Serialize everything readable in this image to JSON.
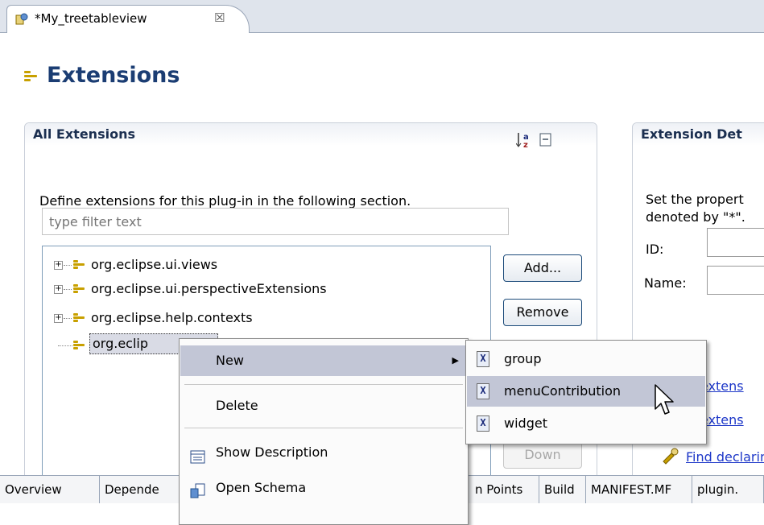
{
  "editor_tab": {
    "title": "*My_treetableview",
    "close_glyph": "☒",
    "icon": "plugin-manifest-icon"
  },
  "page": {
    "title": "Extensions",
    "icon": "extensions-icon"
  },
  "all_extensions": {
    "title": "All Extensions",
    "description": "Define extensions for this plug-in in the following section.",
    "filter_placeholder": "type filter text",
    "sort_icon": "sort-alphabetically-icon",
    "collapse_icon": "collapse-all-icon",
    "tree_items": [
      {
        "label": "org.eclipse.ui.views",
        "expandable": true
      },
      {
        "label": "org.eclipse.ui.perspectiveExtensions",
        "expandable": true
      },
      {
        "label": "org.eclipse.help.contexts",
        "expandable": true
      },
      {
        "label": "org.eclip",
        "expandable": false,
        "selected": true
      }
    ],
    "buttons": {
      "add": "Add...",
      "remove": "Remove",
      "down": "Down"
    }
  },
  "extension_details": {
    "title": "Extension Det",
    "description_line1": "Set the propert",
    "description_line2": "denoted by \"*\".",
    "id_label": "ID:",
    "name_label": "Name:",
    "links": [
      "extens",
      "extens",
      "Find declarin"
    ]
  },
  "context_menu": {
    "items": [
      {
        "label": "New",
        "has_submenu": true,
        "highlighted": true
      },
      {
        "label": "Delete"
      },
      {
        "label": "Show Description",
        "icon": "show-description-icon"
      },
      {
        "label": "Open Schema",
        "icon": "open-schema-icon"
      }
    ]
  },
  "submenu": {
    "items": [
      {
        "label": "group",
        "icon": "xml-element-icon"
      },
      {
        "label": "menuContribution",
        "icon": "xml-element-icon",
        "highlighted": true
      },
      {
        "label": "widget",
        "icon": "xml-element-icon"
      }
    ]
  },
  "bottom_tabs": [
    "Overview",
    "Depende",
    "n Points",
    "Build",
    "MANIFEST.MF",
    "plugin."
  ],
  "colors": {
    "heading": "#1b3d73",
    "menu_highlight": "#c2c6d6",
    "link": "#1d37c8"
  }
}
